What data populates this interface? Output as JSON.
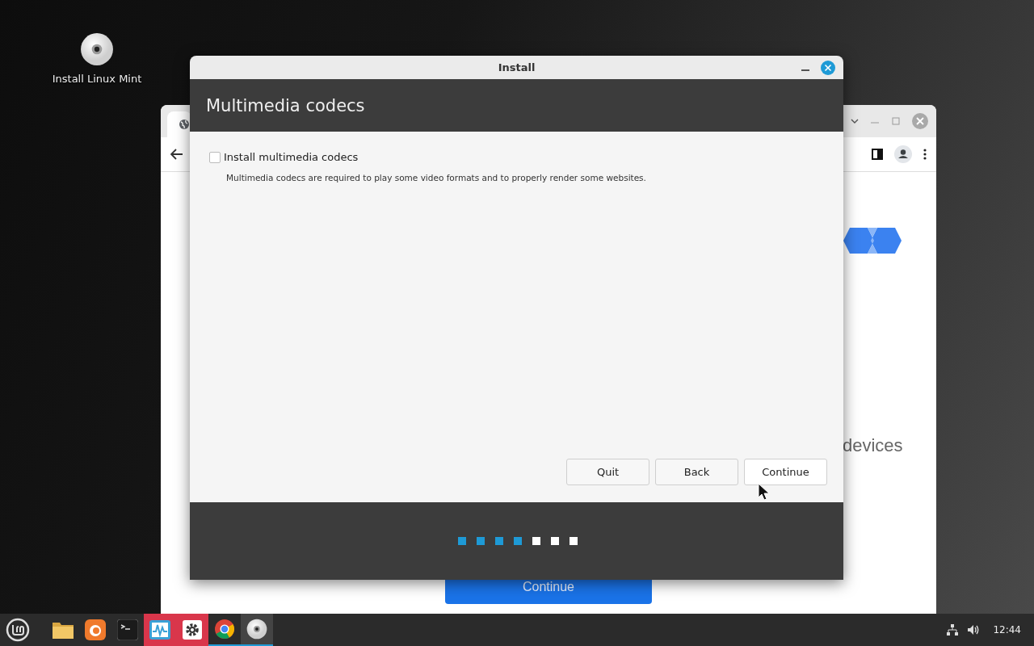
{
  "desktop_icons": [
    {
      "label": "Install Linux Mint"
    }
  ],
  "browser_window": {
    "heading": "devices",
    "button": "Continue"
  },
  "dialog": {
    "title": "Install",
    "heading": "Multimedia codecs",
    "option": {
      "label": "Install multimedia codecs",
      "checked": false
    },
    "description": "Multimedia codecs are required to play some video formats and to properly render some websites.",
    "buttons": [
      "Quit",
      "Back",
      "Continue"
    ],
    "steps": [
      {
        "completed": true
      },
      {
        "completed": true
      },
      {
        "completed": true
      },
      {
        "completed": true
      },
      {
        "completed": false
      },
      {
        "completed": false
      },
      {
        "completed": false
      }
    ]
  },
  "taskbar": {
    "launchers": [
      {
        "kind": "folder",
        "running": false,
        "attention": false
      },
      {
        "kind": "flame",
        "running": false,
        "attention": false
      },
      {
        "kind": "terminal",
        "running": false,
        "attention": false
      },
      {
        "kind": "monitor",
        "running": false,
        "attention": true
      },
      {
        "kind": "gear",
        "running": false,
        "attention": true
      },
      {
        "kind": "globe",
        "running": true,
        "attention": false
      },
      {
        "kind": "disc",
        "running": true,
        "attention": false
      }
    ],
    "clock": "12:44"
  }
}
